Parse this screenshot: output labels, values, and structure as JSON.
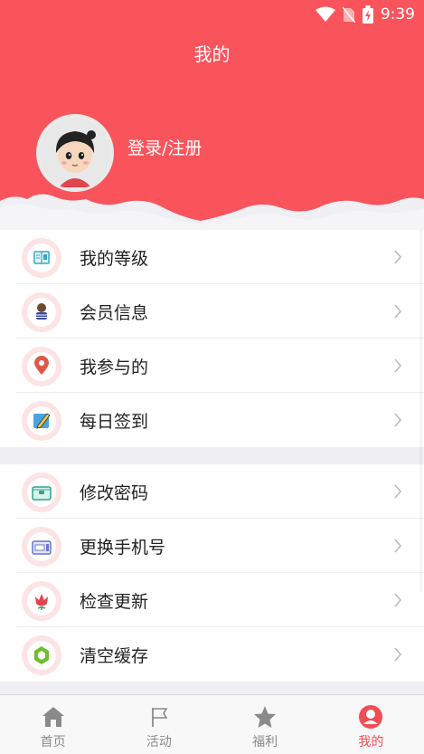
{
  "status_bar": {
    "time": "9:39"
  },
  "header": {
    "title": "我的",
    "login_text": "登录/注册",
    "background_color": "#f9545c"
  },
  "menu_group_1": {
    "items": [
      {
        "label": "我的等级",
        "icon": "level-book-icon"
      },
      {
        "label": "会员信息",
        "icon": "member-person-icon"
      },
      {
        "label": "我参与的",
        "icon": "location-pin-icon"
      },
      {
        "label": "每日签到",
        "icon": "pencil-note-icon"
      }
    ]
  },
  "menu_group_2": {
    "items": [
      {
        "label": "修改密码",
        "icon": "wallet-icon"
      },
      {
        "label": "更换手机号",
        "icon": "card-icon"
      },
      {
        "label": "检查更新",
        "icon": "flower-icon"
      },
      {
        "label": "清空缓存",
        "icon": "hexagon-icon"
      }
    ]
  },
  "tab_bar": {
    "tabs": [
      {
        "label": "首页",
        "icon": "home-icon",
        "active": false
      },
      {
        "label": "活动",
        "icon": "flag-icon",
        "active": false
      },
      {
        "label": "福利",
        "icon": "star-icon",
        "active": false
      },
      {
        "label": "我的",
        "icon": "user-icon",
        "active": true
      }
    ],
    "active_color": "#f24c54",
    "inactive_color": "#8a8a8a"
  }
}
